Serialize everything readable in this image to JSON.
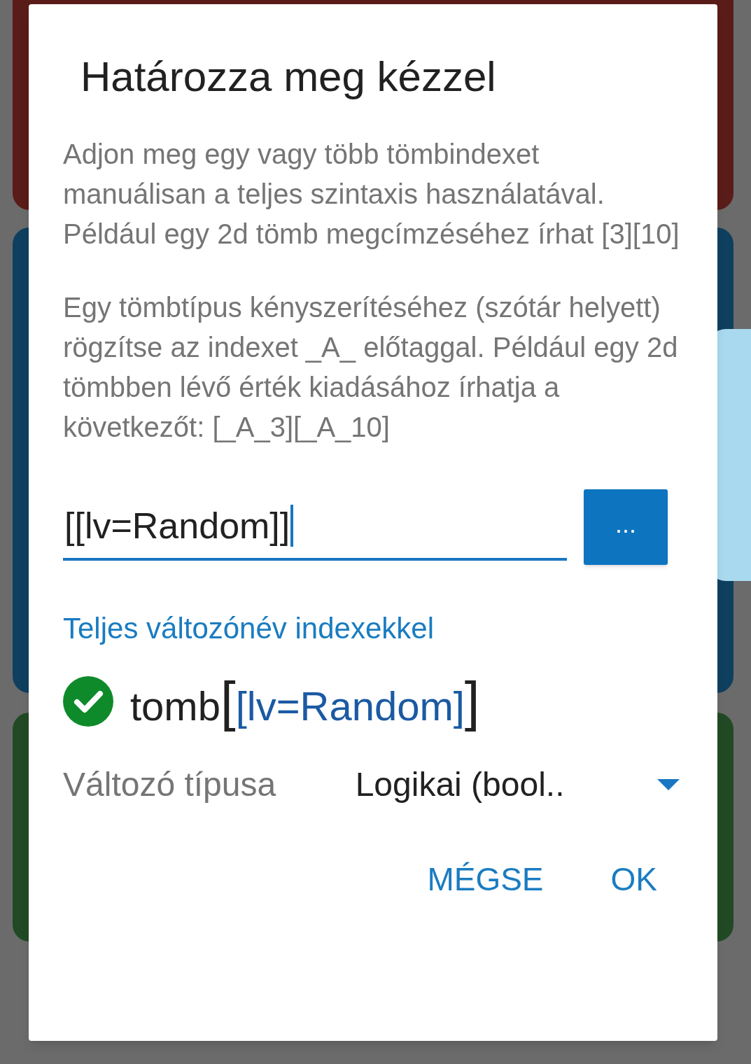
{
  "dialog": {
    "title": "Határozza meg kézzel",
    "paragraphs": [
      "Adjon meg egy vagy több tömbindexet manuálisan a teljes szintaxis használatával. Például egy 2d tömb megcímzéséhez írhat [3][10]",
      "Egy tömbtípus kényszerítéséhez (szótár helyett) rögzítse az indexet _A_ előtaggal. Például egy 2d tömbben lévő érték kiadásához írhatja a következőt: [_A_3][_A_10]"
    ],
    "input": {
      "value": "[[lv=Random]]",
      "focused": true
    },
    "browse_button": "...",
    "section_label": "Teljes változónév indexekkel",
    "result": {
      "valid": true,
      "name": "tomb",
      "open_bracket": "[",
      "index": "[lv=Random]",
      "close_bracket": "]"
    },
    "type_field": {
      "label": "Változó típusa",
      "value": "Logikai (bool.."
    },
    "buttons": [
      "MÉGSE",
      "OK"
    ]
  }
}
